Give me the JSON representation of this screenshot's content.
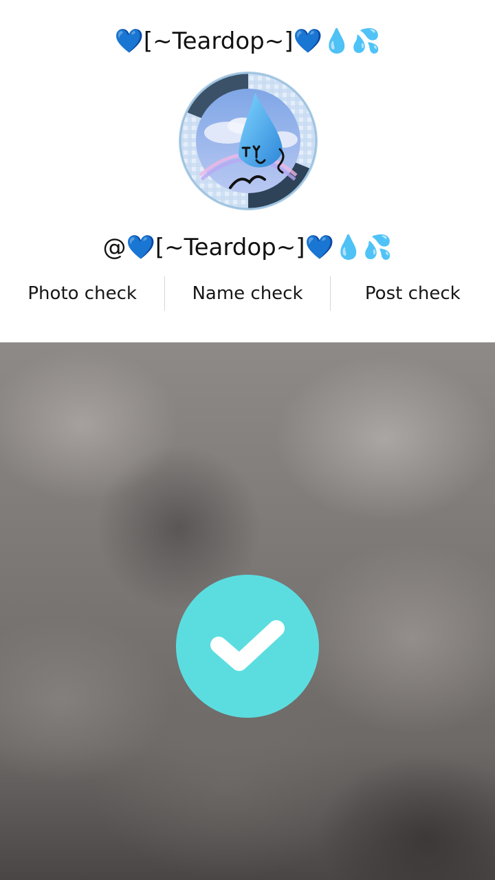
{
  "profile": {
    "display_name": "💙[~Teardop~]💙💧💦",
    "handle": "@💙[~Teardop~]💙💧💦",
    "avatar": "avatar-image"
  },
  "tabs": [
    {
      "label": "Photo check"
    },
    {
      "label": "Name check"
    },
    {
      "label": "Post check"
    }
  ],
  "preview": {
    "confirm_icon": "checkmark-icon"
  },
  "colors": {
    "confirm_button": "#5bdde0",
    "background": "#ffffff",
    "text": "#161616"
  }
}
